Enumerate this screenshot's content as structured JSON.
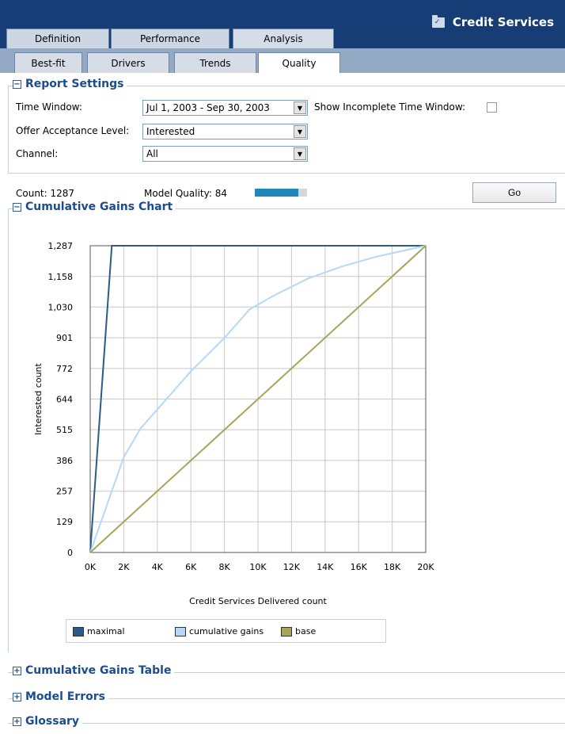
{
  "header": {
    "app_title": "Credit Services",
    "main_tabs": [
      "Definition",
      "Performance",
      "Analysis"
    ],
    "sub_tabs": [
      "Best-fit",
      "Drivers",
      "Trends",
      "Quality"
    ]
  },
  "report_settings": {
    "title": "Report Settings",
    "time_window_label": "Time Window:",
    "time_window_value": "Jul 1, 2003 - Sep 30, 2003",
    "show_incomplete_label": "Show Incomplete Time Window:",
    "offer_acceptance_label": "Offer Acceptance Level:",
    "offer_acceptance_value": "Interested",
    "channel_label": "Channel:",
    "channel_value": "All"
  },
  "summary": {
    "count_label": "Count: 1287",
    "model_quality_label": "Model Quality: 84",
    "model_quality_value": 84,
    "go_label": "Go"
  },
  "sections": {
    "chart_title": "Cumulative Gains Chart",
    "table_title": "Cumulative Gains Table",
    "errors_title": "Model Errors",
    "glossary_title": "Glossary"
  },
  "chart_data": {
    "type": "line",
    "xlabel": "Credit Services Delivered count",
    "ylabel": "Interested count",
    "xlim": [
      0,
      20000
    ],
    "ylim": [
      0,
      1287
    ],
    "x_tick_labels": [
      "0K",
      "2K",
      "4K",
      "6K",
      "8K",
      "10K",
      "12K",
      "14K",
      "16K",
      "18K",
      "20K"
    ],
    "y_tick_labels": [
      "0",
      "129",
      "257",
      "386",
      "515",
      "644",
      "772",
      "901",
      "1,030",
      "1,158",
      "1,287"
    ],
    "y_ticks": [
      0,
      129,
      257,
      386,
      515,
      644,
      772,
      901,
      1030,
      1158,
      1287
    ],
    "grid": true,
    "legend_placement": "bottom",
    "series": [
      {
        "name": "maximal",
        "color": "#2c5b8a",
        "x": [
          0,
          1287,
          20000
        ],
        "y": [
          0,
          1287,
          1287
        ]
      },
      {
        "name": "cumulative gains",
        "color": "#b7d7f7",
        "x": [
          0,
          1000,
          2000,
          3000,
          4000,
          6000,
          8000,
          9500,
          11000,
          13000,
          15000,
          17000,
          20000
        ],
        "y": [
          0,
          200,
          400,
          520,
          600,
          760,
          900,
          1020,
          1080,
          1150,
          1200,
          1240,
          1287
        ]
      },
      {
        "name": "base",
        "color": "#a8a45a",
        "x": [
          0,
          20000
        ],
        "y": [
          0,
          1287
        ]
      }
    ]
  }
}
